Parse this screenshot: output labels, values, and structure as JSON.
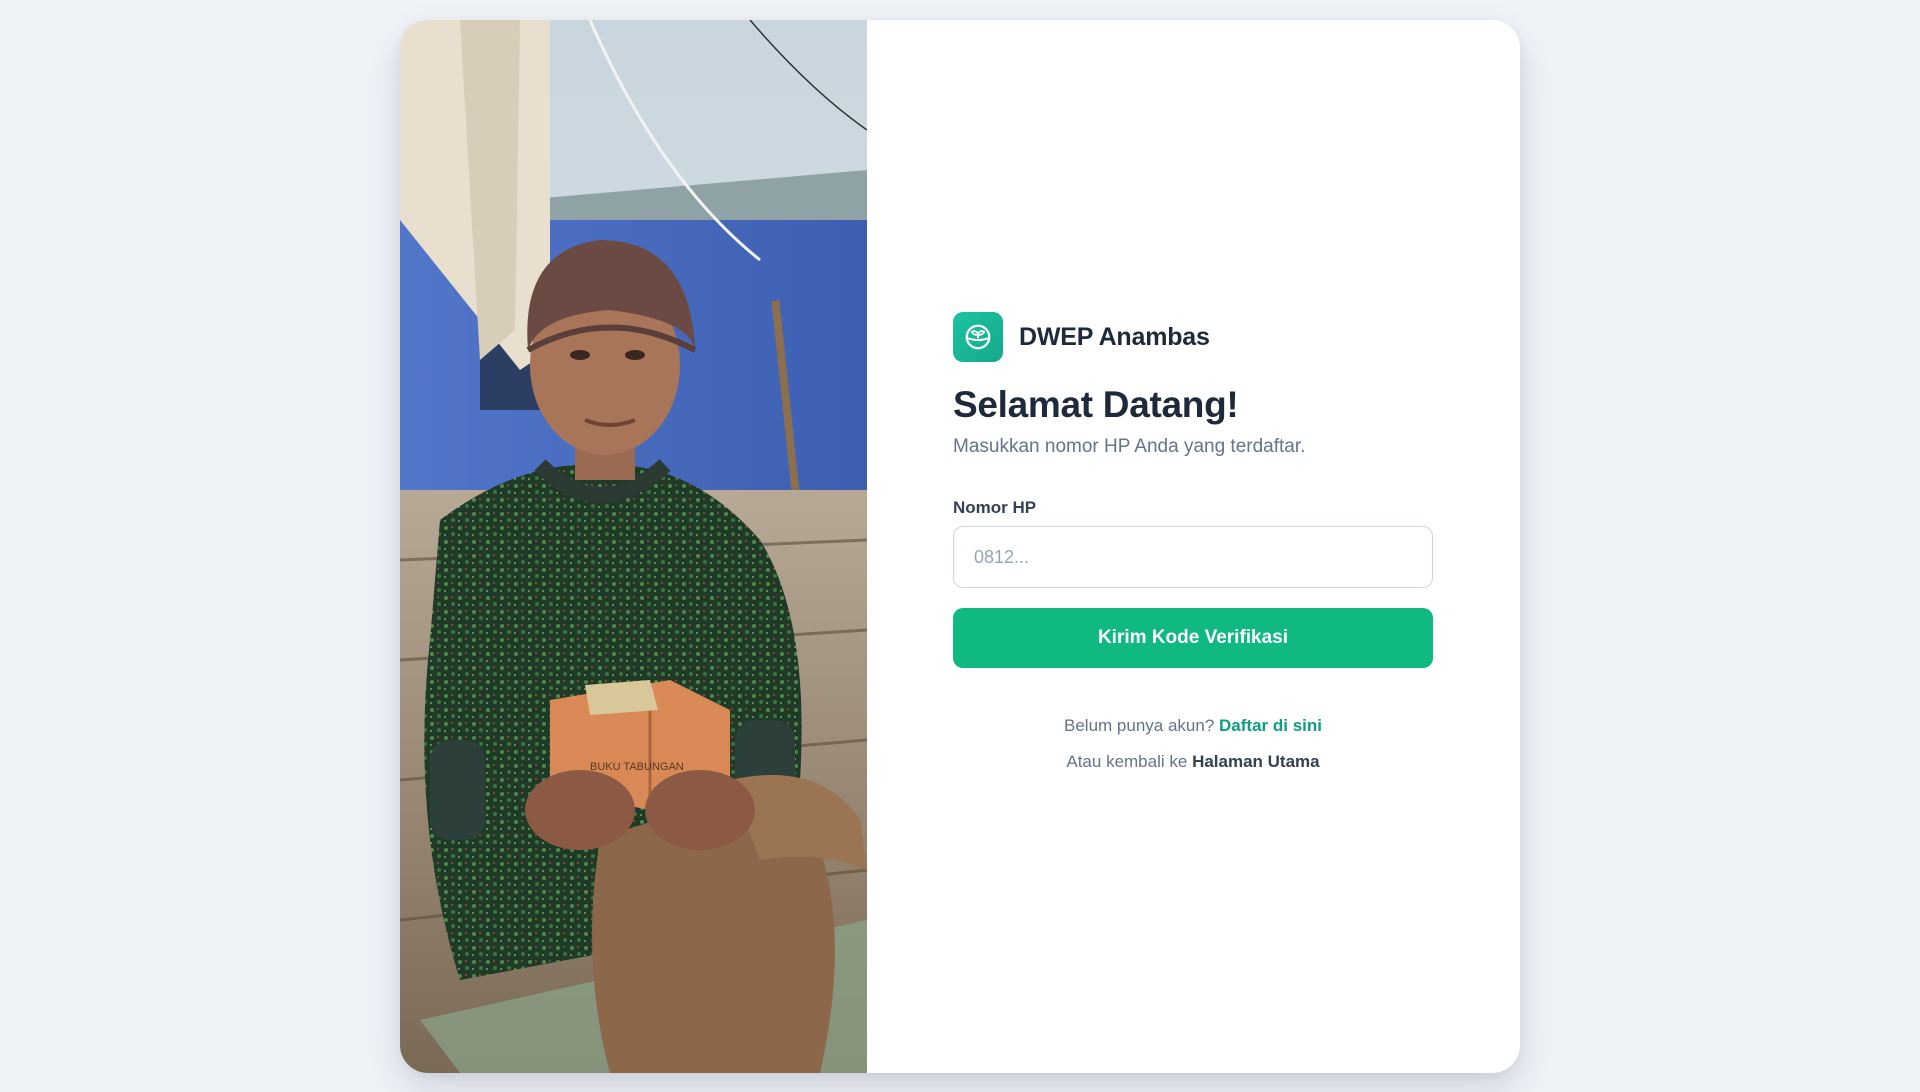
{
  "brand": {
    "name": "DWEP Anambas",
    "logo_icon": "sprout-globe-icon",
    "color": "#17b596"
  },
  "login": {
    "title": "Selamat Datang!",
    "subtitle": "Masukkan nomor HP Anda yang terdaftar.",
    "phone_label": "Nomor HP",
    "phone_placeholder": "0812...",
    "phone_value": "",
    "submit_label": "Kirim Kode Verifikasi",
    "submit_color": "#10b981"
  },
  "footer_links": {
    "register_prompt": "Belum punya akun?",
    "register_link": "Daftar di sini",
    "home_prompt": "Atau kembali ke",
    "home_link": "Halaman Utama"
  },
  "hero": {
    "image_description": "elderly woman holding savings book",
    "book_text": "BUKU TABUNGAN"
  }
}
